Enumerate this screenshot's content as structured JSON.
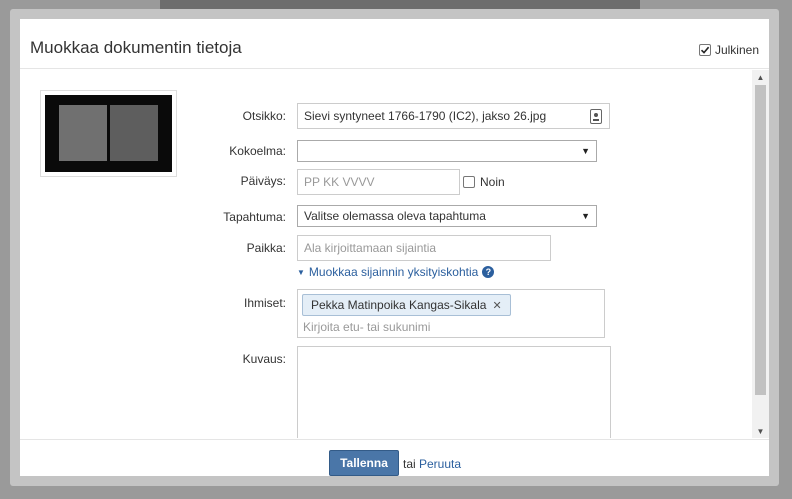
{
  "modal": {
    "title": "Muokkaa dokumentin tietoja",
    "public_label": "Julkinen",
    "public_checked": true
  },
  "form": {
    "title_label": "Otsikko:",
    "title_value": "Sievi syntyneet 1766-1790 (IC2), jakso 26.jpg",
    "collection_label": "Kokoelma:",
    "collection_value": "",
    "date_label": "Päiväys:",
    "date_placeholder": "PP KK VVVV",
    "approx_label": "Noin",
    "event_label": "Tapahtuma:",
    "event_value": "Valitse olemassa oleva tapahtuma",
    "place_label": "Paikka:",
    "place_placeholder": "Ala kirjoittamaan sijaintia",
    "place_details_link": "Muokkaa sijainnin yksityiskohtia",
    "people_label": "Ihmiset:",
    "people_tags": [
      "Pekka Matinpoika Kangas-Sikala"
    ],
    "people_placeholder": "Kirjoita etu- tai sukunimi",
    "description_label": "Kuvaus:"
  },
  "footer": {
    "save_label": "Tallenna",
    "or_text": "tai",
    "cancel_label": "Peruuta"
  },
  "icons": {
    "title_field_icon": "id-card-icon",
    "details_toggle_icon": "chevron-down-icon",
    "help_icon": "question-circle-icon"
  }
}
